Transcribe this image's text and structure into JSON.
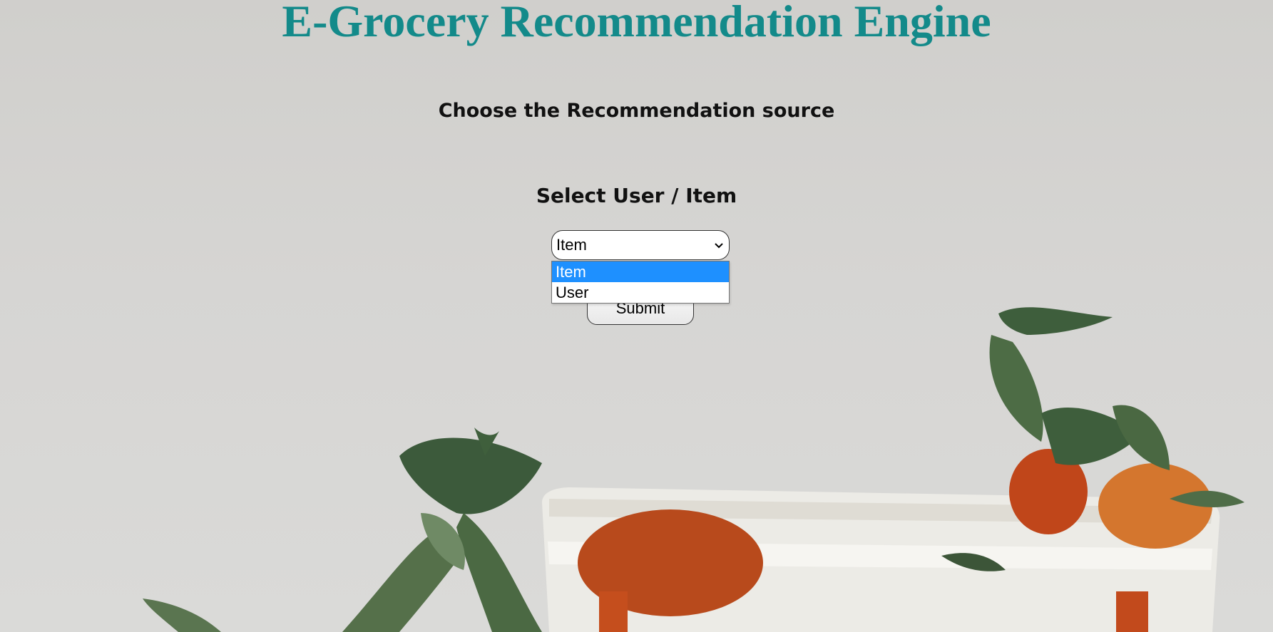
{
  "page": {
    "title": "E-Grocery Recommendation Engine",
    "subtitle": "Choose the Recommendation source",
    "select_label": "Select User / Item"
  },
  "select": {
    "current_value": "Item",
    "options": [
      "Item",
      "User"
    ],
    "highlighted_option": "Item"
  },
  "submit": {
    "label": "Submit"
  },
  "colors": {
    "title": "#138a8a",
    "option_highlight": "#1e90ff",
    "background": "#d6d5d3"
  },
  "icons": {
    "select_arrow": "chevron-down-icon"
  }
}
